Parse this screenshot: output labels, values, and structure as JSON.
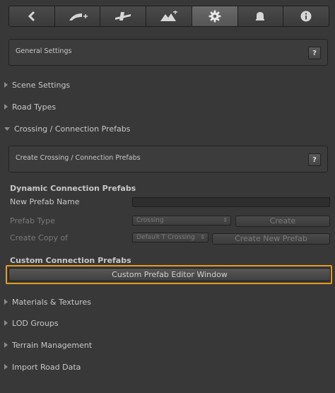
{
  "toolbar": {
    "tools": [
      {
        "icon": "back-arrow-icon"
      },
      {
        "icon": "road-add-icon"
      },
      {
        "icon": "crossing-icon"
      },
      {
        "icon": "terrain-icon"
      },
      {
        "icon": "gear-icon",
        "active": true
      },
      {
        "icon": "bell-icon"
      },
      {
        "icon": "info-icon"
      }
    ]
  },
  "general_settings": {
    "title": "General Settings",
    "help": "?"
  },
  "foldouts": {
    "scene_settings": "Scene Settings",
    "road_types": "Road Types",
    "crossing_prefabs": "Crossing / Connection Prefabs",
    "materials": "Materials & Textures",
    "lod_groups": "LOD Groups",
    "terrain": "Terrain Management",
    "import": "Import Road Data"
  },
  "create_crossing": {
    "title": "Create Crossing / Connection Prefabs",
    "help": "?"
  },
  "dynamic": {
    "title": "Dynamic Connection Prefabs",
    "new_prefab_name_label": "New Prefab Name",
    "new_prefab_name_value": "",
    "prefab_type_label": "Prefab Type",
    "prefab_type_value": "Crossing",
    "create_button": "Create",
    "create_copy_label": "Create Copy of",
    "create_copy_value": "Default T Crossing",
    "create_new_button": "Create New Prefab"
  },
  "custom": {
    "title": "Custom Connection Prefabs",
    "editor_button": "Custom Prefab Editor Window"
  },
  "colors": {
    "highlight": "#e59b21",
    "background": "#383838"
  }
}
